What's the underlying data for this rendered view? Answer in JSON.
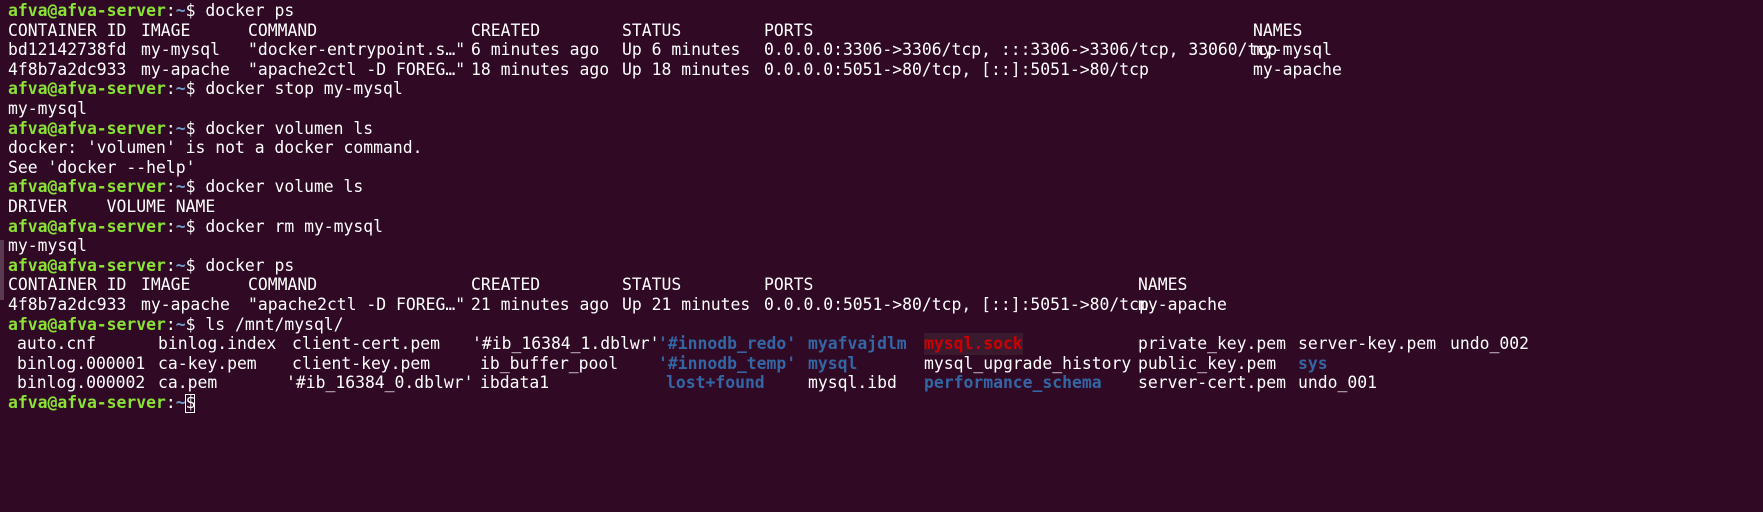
{
  "terminal": {
    "prompt": {
      "user_host": "afva@afva-server",
      "sep": ":",
      "path": "~",
      "sym": "$"
    },
    "lines": [
      {
        "type": "prompt",
        "cmd": "docker ps"
      },
      {
        "type": "table",
        "cols": [
          "CONTAINER ID",
          "IMAGE",
          "COMMAND",
          "CREATED",
          "STATUS",
          "PORTS",
          "NAMES"
        ],
        "header": true,
        "layout": "a"
      },
      {
        "type": "table",
        "cols": [
          "bd12142738fd",
          "my-mysql",
          "\"docker-entrypoint.s…\"",
          "6 minutes ago",
          "Up 6 minutes",
          "0.0.0.0:3306->3306/tcp, :::3306->3306/tcp, 33060/tcp",
          "my-mysql"
        ],
        "layout": "a"
      },
      {
        "type": "table",
        "cols": [
          "4f8b7a2dc933",
          "my-apache",
          "\"apache2ctl -D FOREG…\"",
          "18 minutes ago",
          "Up 18 minutes",
          "0.0.0.0:5051->80/tcp, [::]:5051->80/tcp",
          "my-apache"
        ],
        "layout": "a"
      },
      {
        "type": "prompt",
        "cmd": "docker stop my-mysql"
      },
      {
        "type": "out",
        "text": "my-mysql"
      },
      {
        "type": "prompt",
        "cmd": "docker volumen ls"
      },
      {
        "type": "out",
        "text": "docker: 'volumen' is not a docker command."
      },
      {
        "type": "out",
        "text": "See 'docker --help'"
      },
      {
        "type": "prompt",
        "cmd": "docker volume ls"
      },
      {
        "type": "out",
        "text": "DRIVER    VOLUME NAME"
      },
      {
        "type": "prompt",
        "cmd": "docker rm my-mysql"
      },
      {
        "type": "out",
        "text": "my-mysql"
      },
      {
        "type": "prompt",
        "cmd": "docker ps"
      },
      {
        "type": "table",
        "cols": [
          "CONTAINER ID",
          "IMAGE",
          "COMMAND",
          "CREATED",
          "STATUS",
          "PORTS",
          "NAMES"
        ],
        "layout": "b"
      },
      {
        "type": "table",
        "cols": [
          "4f8b7a2dc933",
          "my-apache",
          "\"apache2ctl -D FOREG…\"",
          "21 minutes ago",
          "Up 21 minutes",
          "0.0.0.0:5051->80/tcp, [::]:5051->80/tcp",
          "my-apache"
        ],
        "layout": "b"
      },
      {
        "type": "prompt",
        "cmd": "ls /mnt/mysql/"
      },
      {
        "type": "ls",
        "items": [
          {
            "t": "auto.cnf",
            "c": "white"
          },
          {
            "t": "binlog.index",
            "c": "white"
          },
          {
            "t": "client-cert.pem",
            "c": "white"
          },
          {
            "t": "'#ib_16384_1.dblwr'",
            "c": "white"
          },
          {
            "t": "'#innodb_redo'",
            "c": "dirblue"
          },
          {
            "t": "myafvajdlm",
            "c": "dirblue"
          },
          {
            "t": "mysql.sock",
            "c": "red"
          },
          {
            "t": "private_key.pem",
            "c": "white"
          },
          {
            "t": "server-key.pem",
            "c": "white"
          },
          {
            "t": "undo_002",
            "c": "white"
          }
        ]
      },
      {
        "type": "ls",
        "items": [
          {
            "t": "binlog.000001",
            "c": "white"
          },
          {
            "t": "ca-key.pem",
            "c": "white"
          },
          {
            "t": "client-key.pem",
            "c": "white"
          },
          {
            "t": "ib_buffer_pool",
            "c": "white"
          },
          {
            "t": "'#innodb_temp'",
            "c": "dirblue"
          },
          {
            "t": "mysql",
            "c": "dirblue"
          },
          {
            "t": "mysql_upgrade_history",
            "c": "white"
          },
          {
            "t": "public_key.pem",
            "c": "white"
          },
          {
            "t": "sys",
            "c": "dirblue"
          }
        ]
      },
      {
        "type": "ls",
        "items": [
          {
            "t": "binlog.000002",
            "c": "white"
          },
          {
            "t": "ca.pem",
            "c": "white"
          },
          {
            "t": "'#ib_16384_0.dblwr'",
            "c": "white"
          },
          {
            "t": "ibdata1",
            "c": "white"
          },
          {
            "t": "lost+found",
            "c": "dirblue"
          },
          {
            "t": "mysql.ibd",
            "c": "white"
          },
          {
            "t": "performance_schema",
            "c": "dirblue"
          },
          {
            "t": "server-cert.pem",
            "c": "white"
          },
          {
            "t": "undo_001",
            "c": "white"
          }
        ]
      },
      {
        "type": "prompt",
        "cmd": "",
        "cursor": true
      }
    ]
  }
}
